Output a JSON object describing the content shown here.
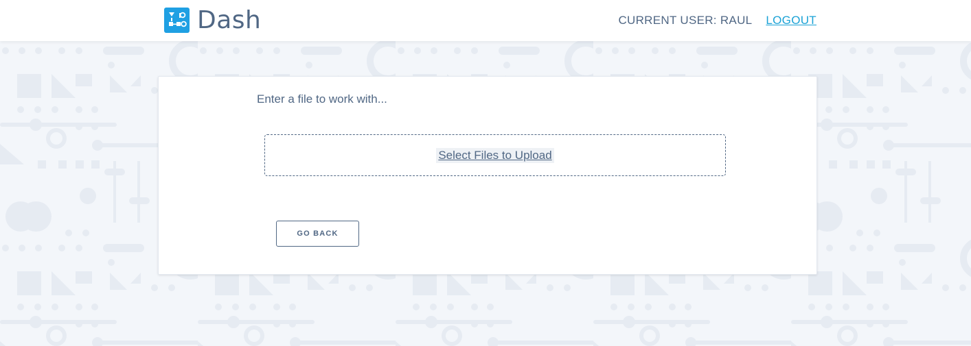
{
  "header": {
    "logo_text": "Dash",
    "current_user_label": "CURRENT USER: RAUL",
    "logout_label": "LOGOUT"
  },
  "main": {
    "prompt": "Enter a file to work with...",
    "upload_label": "Select Files to Upload",
    "back_button_label": "GO BACK"
  },
  "colors": {
    "text": "#506784",
    "link": "#1aa2d6",
    "logo_blue": "#1fa0e3",
    "background": "#f3f6fa",
    "pattern": "#e6ebf2"
  },
  "icons": {
    "logo": "dash-logo-icon"
  }
}
